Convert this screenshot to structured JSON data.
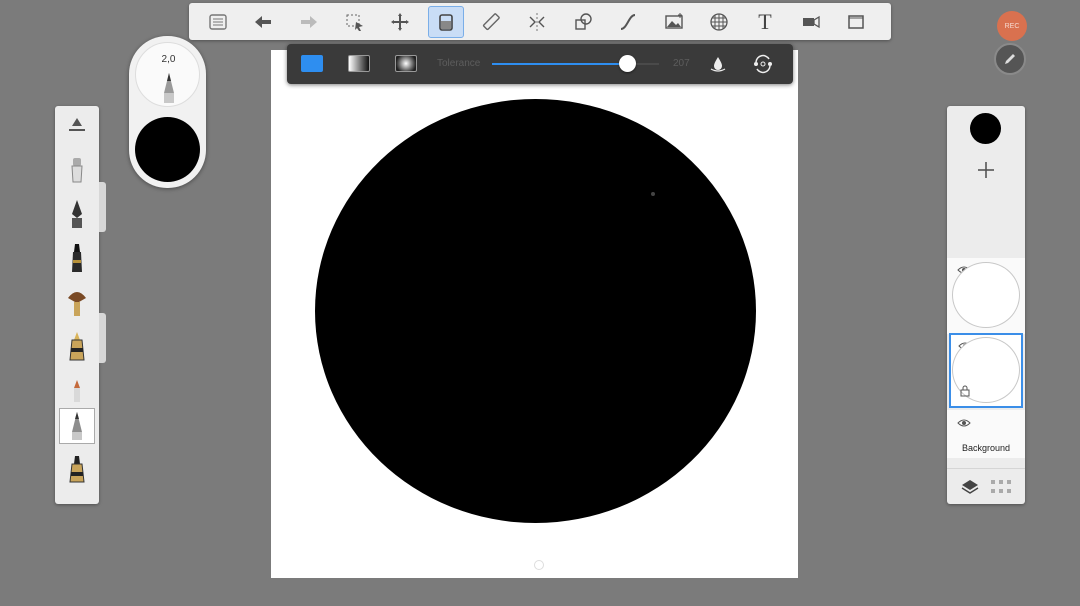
{
  "toolbar": {
    "tools": [
      {
        "name": "menu-list-icon"
      },
      {
        "name": "undo-icon"
      },
      {
        "name": "redo-icon"
      },
      {
        "name": "selection-icon"
      },
      {
        "name": "transform-icon"
      },
      {
        "name": "fill-icon",
        "active": true
      },
      {
        "name": "ruler-icon"
      },
      {
        "name": "symmetry-icon"
      },
      {
        "name": "shapes-icon"
      },
      {
        "name": "curve-icon"
      },
      {
        "name": "image-icon"
      },
      {
        "name": "perspective-icon"
      },
      {
        "name": "text-icon"
      },
      {
        "name": "video-icon"
      },
      {
        "name": "fullscreen-icon"
      }
    ],
    "text_glyph": "T"
  },
  "fill_options": {
    "modes": [
      "solid",
      "linear-gradient",
      "radial-gradient"
    ],
    "selected_mode": "solid",
    "tolerance_label": "Tolerance",
    "tolerance_value": "207",
    "tolerance_fraction": 0.81,
    "accent": "#2e8ef0"
  },
  "brush_puck": {
    "size_value": "2,0",
    "color": "#000000"
  },
  "brush_palette": {
    "brushes": [
      "opacity-slider-icon",
      "airbrush-icon",
      "ink-pen-icon",
      "marker-icon",
      "fan-brush-icon",
      "paint-brush-icon",
      "crayon-icon",
      "pencil-icon",
      "chisel-brush-icon"
    ],
    "selected_index": 7
  },
  "layers": {
    "current_color": "#000000",
    "items": [
      {
        "name": "layer-1",
        "visible": true,
        "selected": false
      },
      {
        "name": "layer-2",
        "visible": true,
        "selected": true,
        "locked": true
      },
      {
        "name": "background",
        "label": "Background",
        "visible": true
      }
    ]
  },
  "status": {
    "record_label": "REC"
  }
}
